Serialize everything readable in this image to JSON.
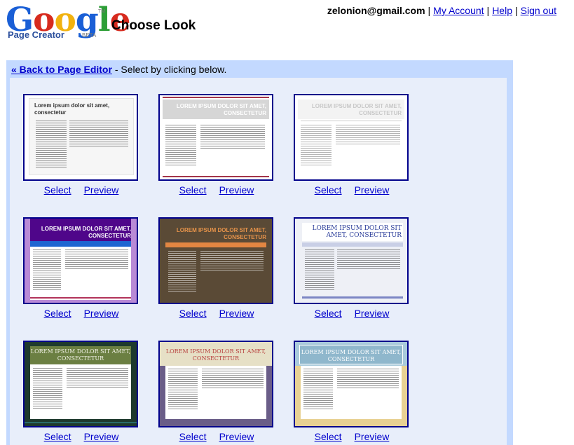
{
  "header": {
    "logo_text": "Google",
    "logo_sub": "Page Creator",
    "logo_beta": "BETA",
    "logo_tm": "TM",
    "title": "Choose Look",
    "user_email": "zelonion@gmail.com",
    "links": [
      "My Account",
      "Help",
      "Sign out"
    ],
    "separator": "|"
  },
  "panel": {
    "back_link": "« Back to Page Editor",
    "instruction": " - Select by clicking below."
  },
  "select_label": "Select",
  "preview_label": "Preview",
  "looks": [
    {
      "title": "Lorem ipsum dolor sit amet, consectetur"
    },
    {
      "title": "LOREM IPSUM DOLOR SIT AMET, CONSECTETUR"
    },
    {
      "title": "LOREM IPSUM DOLOR SIT AMET, CONSECTETUR"
    },
    {
      "title": "LOREM IPSUM DOLOR SIT AMET, CONSECTETUR"
    },
    {
      "title": "LOREM IPSUM DOLOR SIT AMET, CONSECTETUR"
    },
    {
      "title": "LOREM IPSUM DOLOR SIT AMET, CONSECTETUR"
    },
    {
      "title": "LOREM IPSUM DOLOR SIT AMET, CONSECTETUR"
    },
    {
      "title": "LOREM IPSUM DOLOR SIT AMET, CONSECTETUR"
    },
    {
      "title": "LOREM IPSUM DOLOR SIT AMET, CONSECTETUR"
    }
  ],
  "colors": {
    "panel_bg": "#c3d9ff",
    "inner_bg": "#e8eefa",
    "thumb_border": "#00008b",
    "link": "#0000cc"
  }
}
